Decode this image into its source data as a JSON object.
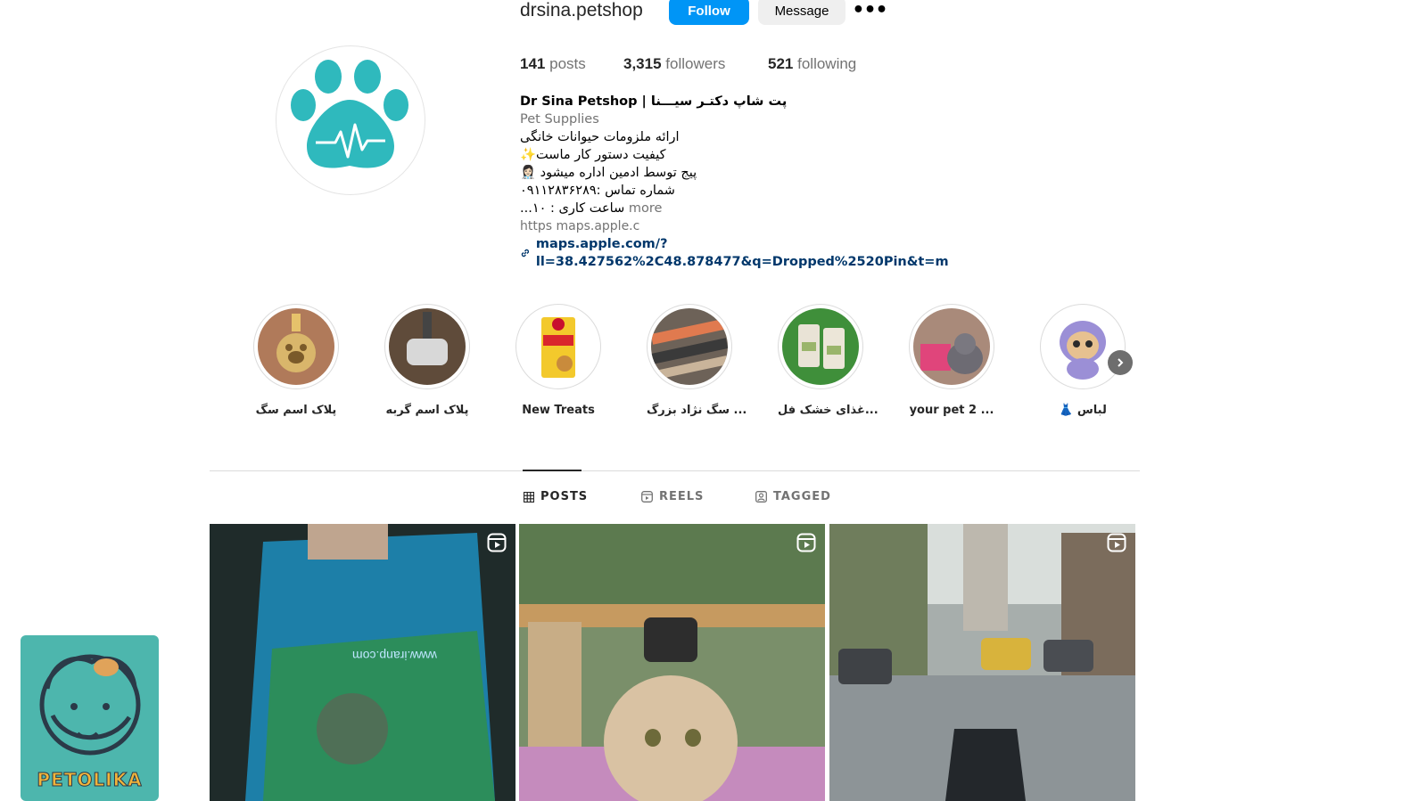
{
  "profile": {
    "username": "drsina.petshop",
    "follow_label": "Follow",
    "message_label": "Message",
    "more_label": "•••",
    "stats": {
      "posts_count": "141",
      "posts_label": "posts",
      "followers_count": "3,315",
      "followers_label": "followers",
      "following_count": "521",
      "following_label": "following"
    },
    "bio": {
      "name": "Dr Sina Petshop | پت شاپ دکتـر سیـــنا",
      "category": "Pet Supplies",
      "line1": "ارائه ملزومات حیوانات خانگی",
      "line2": "کیفیت دستور کار ماست✨",
      "line3": "پیج توسط ادمین اداره میشود 👩🏻‍⚕️",
      "line4": "شماره تماس :۰۹۱۱۲۸۳۶۲۸۹",
      "line5": "ساعت کاری : ۱۰...",
      "more_label": "more",
      "url_text": "https maps.apple.c",
      "link_text": "maps.apple.com/?ll=38.427562%2C48.878477&q=Dropped%2520Pin&t=m"
    }
  },
  "highlights": [
    {
      "label": "پلاک اسم سگ",
      "icon": "dog-tag-photo"
    },
    {
      "label": "پلاک اسم گربه",
      "icon": "cat-tag-photo"
    },
    {
      "label": "New Treats",
      "icon": "treats-box-photo"
    },
    {
      "label": "سگ نژاد بزرگ ...",
      "icon": "collars-photo"
    },
    {
      "label": "غذای خشک فل...",
      "icon": "dry-food-photo"
    },
    {
      "label": "your pet 2 ...",
      "icon": "cat-photo"
    },
    {
      "label": "👗 لباس",
      "icon": "cartoon-dog-photo"
    }
  ],
  "tabs": {
    "posts": "POSTS",
    "reels": "REELS",
    "tagged": "TAGGED"
  },
  "posts": [
    {
      "icon": "reel-icon",
      "caption_text": "www.iranp.com"
    },
    {
      "icon": "reel-icon"
    },
    {
      "icon": "reel-icon"
    }
  ],
  "watermark": {
    "text": "PETOLIKA"
  },
  "colors": {
    "follow_button": "#0095f6",
    "link": "#00376b",
    "avatar_paw": "#2fb9bd",
    "watermark_bg": "#4db6ad"
  }
}
